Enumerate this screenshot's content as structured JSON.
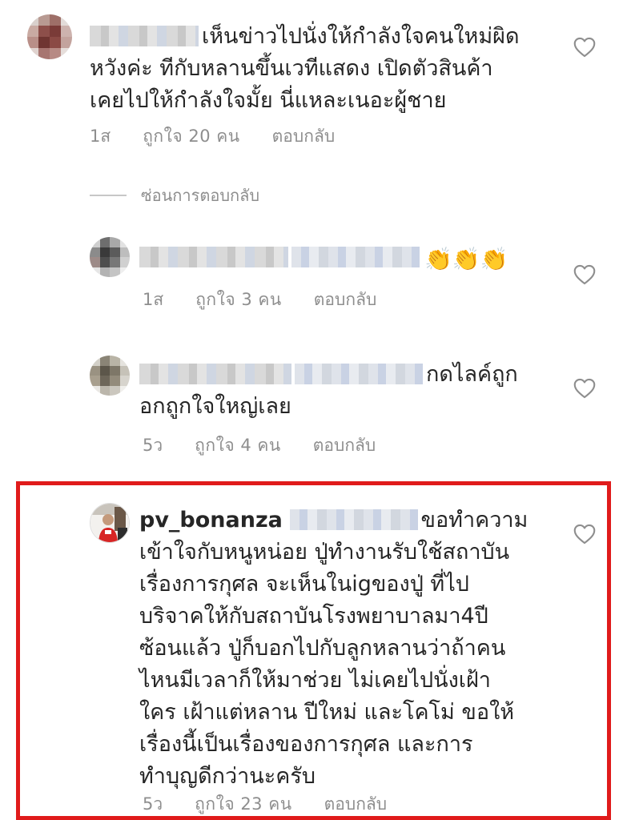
{
  "comments": [
    {
      "text": "เห็นข่าวไปนั่งให้กำลังใจคนใหม่ผิดหวังค่ะ ทีกับหลานขึ้นเวทีแสดง เปิดตัวสินค้าเคยไปให้กำลังใจมั้ย นี่แหละเนอะผู้ชาย",
      "lines": [
        "เห็นข่าวไปนั่งให้กำลังใจคนใหม่ผิด",
        "หวังค่ะ ทีกับหลานขึ้นเวทีแสดง เปิดตัวสินค้า",
        "เคยไปให้กำลังใจมั้ย นี่แหละเนอะผู้ชาย"
      ],
      "time": "1ส",
      "likes": "ถูกใจ 20 คน",
      "reply": "ตอบกลับ",
      "heart_icon": "heart-outline-icon"
    },
    {
      "text": "👏👏👏",
      "time": "1ส",
      "likes": "ถูกใจ 3 คน",
      "reply": "ตอบกลับ",
      "heart_icon": "heart-outline-icon"
    },
    {
      "lines": [
        "กดไลค์ถูก",
        "อกถูกใจใหญ่เลย"
      ],
      "time": "5ว",
      "likes": "ถูกใจ 4 คน",
      "reply": "ตอบกลับ",
      "heart_icon": "heart-outline-icon"
    },
    {
      "username": "pv_bonanza",
      "lines": [
        "ขอทำความ",
        "เข้าใจกับหนูหน่อย ปู่ทำงานรับใช้สถาบัน",
        "เรื่องการกุศล จะเห็นในigของปู่ ที่ไป",
        "บริจาคให้กับสถาบันโรงพยาบาลมา4ปี",
        "ซ้อนแล้ว ปู่ก็บอกไปกับลูกหลานว่าถ้าคน",
        "ไหนมีเวลาก็ให้มาช่วย ไม่เคยไปนั่งเฝ้า",
        "ใคร เฝ้าแต่หลาน ปีใหม่ และโคโม่ ขอให้",
        "เรื่องนี้เป็นเรื่องของการกุศล และการ",
        "ทำบุญดีกว่านะครับ"
      ],
      "time": "5ว",
      "likes": "ถูกใจ 23 คน",
      "reply": "ตอบกลับ",
      "heart_icon": "heart-outline-icon"
    }
  ],
  "hide_replies": "ซ่อนการตอบกลับ",
  "colors": {
    "text": "#262626",
    "meta": "#8e8e8e",
    "highlight": "#e01b1b"
  }
}
